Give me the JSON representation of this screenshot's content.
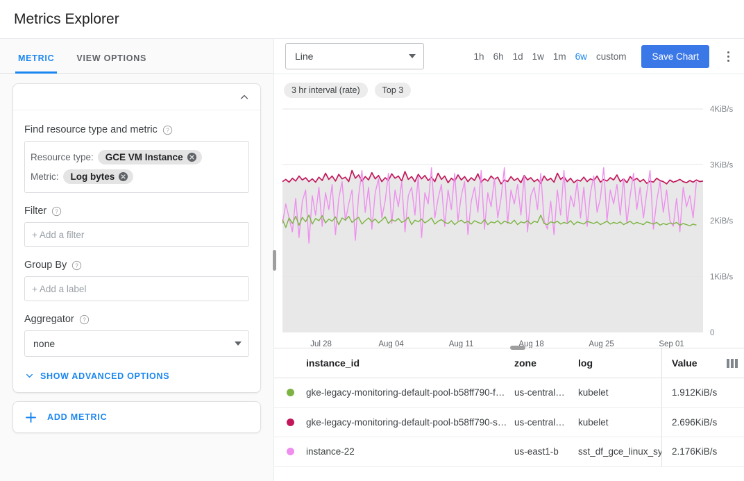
{
  "header": {
    "title": "Metrics Explorer"
  },
  "left": {
    "tabs": [
      {
        "label": "METRIC",
        "active": true
      },
      {
        "label": "VIEW OPTIONS",
        "active": false
      }
    ],
    "find_label": "Find resource type and metric",
    "resource_key": "Resource type:",
    "resource_value": "GCE VM Instance",
    "metric_key": "Metric:",
    "metric_value": "Log bytes",
    "filter_label": "Filter",
    "filter_placeholder": "+ Add a filter",
    "group_by_label": "Group By",
    "group_by_placeholder": "+ Add a label",
    "aggregator_label": "Aggregator",
    "aggregator_value": "none",
    "advanced_label": "SHOW ADVANCED OPTIONS",
    "add_metric_label": "ADD METRIC"
  },
  "toolbar": {
    "chart_type": "Line",
    "ranges": [
      "1h",
      "6h",
      "1d",
      "1w",
      "1m",
      "6w",
      "custom"
    ],
    "active_range": "6w",
    "save_label": "Save Chart"
  },
  "badges": [
    "3 hr interval (rate)",
    "Top 3"
  ],
  "chart_data": {
    "type": "line",
    "title": "",
    "xlabel": "",
    "ylabel": "",
    "ylim": [
      0,
      4
    ],
    "y_ticks": [
      0,
      1,
      2,
      3,
      4
    ],
    "y_tick_labels": [
      "0",
      "1KiB/s",
      "2KiB/s",
      "3KiB/s",
      "4KiB/s"
    ],
    "x_tick_labels": [
      "Jul 28",
      "Aug 04",
      "Aug 11",
      "Aug 18",
      "Aug 25",
      "Sep 01"
    ],
    "grid": true,
    "legend": "below-table",
    "series": [
      {
        "name": "gke-legacy-monitoring-default-pool-b58ff790-s...",
        "color": "#c2185b",
        "values": [
          2.7,
          2.74,
          2.69,
          2.76,
          2.71,
          2.8,
          2.73,
          2.77,
          2.7,
          2.75,
          2.69,
          2.78,
          2.72,
          2.85,
          2.74,
          2.8,
          2.71,
          2.83,
          2.75,
          2.78,
          2.7,
          2.9,
          2.76,
          2.82,
          2.71,
          2.79,
          2.73,
          2.86,
          2.75,
          2.81,
          2.7,
          2.77,
          2.72,
          2.84,
          2.76,
          2.8,
          2.71,
          2.88,
          2.74,
          2.79,
          2.7,
          2.83,
          2.75,
          2.81,
          2.72,
          2.78,
          2.7,
          2.85,
          2.74,
          2.8,
          2.68,
          2.76,
          2.71,
          2.82,
          2.73,
          2.79,
          2.7,
          2.77,
          2.72,
          2.84,
          2.69,
          2.75,
          2.71,
          2.8,
          2.74,
          2.78,
          2.66,
          2.73,
          2.7,
          2.79,
          2.72,
          2.76,
          2.68,
          2.81,
          2.73,
          2.77,
          2.7,
          2.74,
          2.67,
          2.8,
          2.72,
          2.76,
          2.69,
          2.85,
          2.74,
          2.79,
          2.7,
          2.76,
          2.68,
          2.73,
          2.71,
          2.78,
          2.7,
          2.75,
          2.72,
          2.8,
          2.69,
          2.74,
          2.71,
          2.77,
          2.73,
          2.82,
          2.7,
          2.75,
          2.68,
          2.79,
          2.72,
          2.76,
          2.7,
          2.74,
          2.67,
          2.71,
          2.69,
          2.76,
          2.72,
          2.7,
          2.66,
          2.73,
          2.69,
          2.71,
          2.74,
          2.7,
          2.68,
          2.72,
          2.69,
          2.73,
          2.7,
          2.71
        ]
      },
      {
        "name": "instance-22",
        "color": "#ee8fee",
        "values": [
          1.95,
          2.3,
          2.05,
          1.8,
          2.4,
          1.7,
          2.35,
          2.55,
          1.6,
          2.45,
          2.1,
          2.6,
          1.9,
          2.5,
          2.2,
          2.65,
          1.75,
          2.4,
          2.7,
          2.0,
          2.3,
          2.55,
          1.65,
          2.45,
          2.9,
          2.15,
          2.6,
          1.85,
          2.5,
          2.75,
          2.05,
          2.35,
          2.85,
          1.95,
          2.55,
          2.25,
          2.7,
          1.8,
          2.45,
          2.6,
          2.1,
          2.8,
          1.7,
          2.5,
          2.3,
          2.95,
          2.05,
          2.4,
          2.65,
          1.9,
          2.55,
          2.2,
          2.85,
          2.0,
          2.45,
          2.7,
          1.75,
          2.35,
          2.6,
          2.15,
          2.9,
          1.85,
          2.5,
          2.25,
          2.75,
          2.05,
          2.4,
          2.95,
          1.95,
          2.55,
          2.3,
          2.65,
          2.1,
          2.8,
          1.8,
          2.45,
          2.6,
          2.2,
          2.85,
          2.0,
          1.85,
          2.35,
          1.75,
          2.55,
          2.1,
          2.9,
          1.95,
          2.45,
          2.25,
          2.7,
          2.05,
          2.6,
          1.9,
          2.5,
          2.8,
          2.15,
          2.4,
          2.95,
          2.0,
          2.55,
          2.3,
          2.65,
          2.1,
          2.75,
          1.95,
          2.45,
          2.85,
          2.2,
          2.6,
          2.05,
          2.5,
          2.9,
          1.85,
          2.35,
          2.7,
          2.15,
          2.55,
          2.0,
          1.9,
          2.4,
          1.8,
          2.6,
          2.25,
          2.45,
          2.05,
          2.7
        ]
      },
      {
        "name": "gke-legacy-monitoring-default-pool-b58ff790-f...",
        "color": "#7cb342",
        "values": [
          2.02,
          1.88,
          2.05,
          1.95,
          2.08,
          1.92,
          2.06,
          1.98,
          2.1,
          1.94,
          2.04,
          2.0,
          2.09,
          1.96,
          2.03,
          1.99,
          2.07,
          1.93,
          2.05,
          2.01,
          2.08,
          1.97,
          2.02,
          2.06,
          1.94,
          2.0,
          2.05,
          1.98,
          2.03,
          1.96,
          2.01,
          2.07,
          1.95,
          2.02,
          1.99,
          2.04,
          1.97,
          2.0,
          2.06,
          1.93,
          2.01,
          1.98,
          2.03,
          1.96,
          2.0,
          2.05,
          1.94,
          1.99,
          2.02,
          1.97,
          1.95,
          2.0,
          1.93,
          1.98,
          2.01,
          1.96,
          1.99,
          1.94,
          2.0,
          1.97,
          1.95,
          2.02,
          1.93,
          1.98,
          1.96,
          2.0,
          1.94,
          1.99,
          1.97,
          1.95,
          2.01,
          1.93,
          1.98,
          1.96,
          2.0,
          1.94,
          1.99,
          1.97,
          2.1,
          1.95,
          1.93,
          1.98,
          1.96,
          1.99,
          1.94,
          1.97,
          1.95,
          2.0,
          1.93,
          1.98,
          1.96,
          1.94,
          1.99,
          1.97,
          1.95,
          1.98,
          1.93,
          1.96,
          1.99,
          1.94,
          1.97,
          1.95,
          1.98,
          1.93,
          1.96,
          1.99,
          1.94,
          1.97,
          1.95,
          1.93,
          1.98,
          1.96,
          1.94,
          1.97,
          1.92,
          1.95,
          1.93,
          1.96,
          1.94,
          1.97,
          1.92,
          1.95,
          1.93,
          1.91,
          1.94,
          1.92
        ]
      }
    ]
  },
  "table": {
    "columns": [
      "instance_id",
      "zone",
      "log",
      "Value"
    ],
    "rows": [
      {
        "color": "#7cb342",
        "instance_id": "gke-legacy-monitoring-default-pool-b58ff790-f…",
        "zone": "us-central…",
        "log": "kubelet",
        "value": "1.912KiB/s"
      },
      {
        "color": "#c2185b",
        "instance_id": "gke-legacy-monitoring-default-pool-b58ff790-s…",
        "zone": "us-central…",
        "log": "kubelet",
        "value": "2.696KiB/s"
      },
      {
        "color": "#ee8fee",
        "instance_id": "instance-22",
        "zone": "us-east1-b",
        "log": "sst_df_gce_linux_sy",
        "value": "2.176KiB/s"
      }
    ]
  },
  "colors": {
    "accent_blue": "#1a86f0",
    "button_blue": "#3b78e7",
    "series_green": "#7cb342",
    "series_crimson": "#c2185b",
    "series_magenta": "#ee8fee"
  }
}
